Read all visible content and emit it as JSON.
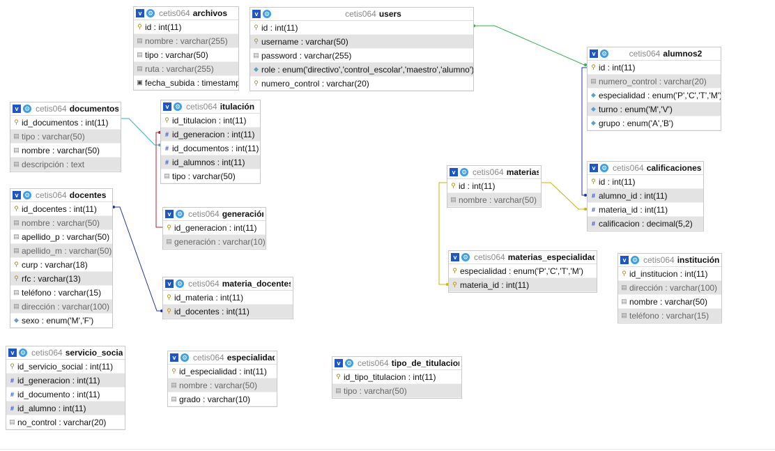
{
  "db_prefix": "cetis064",
  "colors": {
    "rel_green": "#2fb34a",
    "rel_blue": "#2233aa",
    "rel_red": "#b02030",
    "rel_yellow": "#d4b000",
    "rel_cyan": "#28b4c8"
  },
  "tables": {
    "archivos": {
      "name": "archivos",
      "rows": [
        {
          "key": "pk",
          "text": "id : int(11)"
        },
        {
          "key": "plain",
          "text": "nombre : varchar(255)"
        },
        {
          "key": "plain",
          "text": "tipo : varchar(50)"
        },
        {
          "key": "plain",
          "text": "ruta : varchar(255)"
        },
        {
          "key": "idx",
          "text": "fecha_subida : timestamp"
        }
      ]
    },
    "users": {
      "name": "users",
      "rows": [
        {
          "key": "pk",
          "text": "id : int(11)"
        },
        {
          "key": "pk",
          "text": "username : varchar(50)"
        },
        {
          "key": "plain",
          "text": "password : varchar(255)"
        },
        {
          "key": "en",
          "text": "role : enum('directivo','control_escolar','maestro','alumno')"
        },
        {
          "key": "pk",
          "text": "numero_control : varchar(20)"
        }
      ]
    },
    "alumnos2": {
      "name": "alumnos2",
      "rows": [
        {
          "key": "pk",
          "text": "id : int(11)"
        },
        {
          "key": "plain",
          "text": "numero_control : varchar(20)"
        },
        {
          "key": "en",
          "text": "especialidad : enum('P','C','T','M')"
        },
        {
          "key": "en",
          "text": "turno : enum('M','V')"
        },
        {
          "key": "en",
          "text": "grupo : enum('A','B')"
        }
      ]
    },
    "documentos": {
      "name": "documentos",
      "rows": [
        {
          "key": "pk",
          "text": "id_documentos : int(11)"
        },
        {
          "key": "plain",
          "text": "tipo : varchar(50)"
        },
        {
          "key": "plain",
          "text": "nombre : varchar(50)"
        },
        {
          "key": "plain",
          "text": "descripción : text"
        }
      ]
    },
    "titulacion": {
      "name": "itulación",
      "rows": [
        {
          "key": "pk",
          "text": "id_titulacion : int(11)"
        },
        {
          "key": "fk",
          "text": "id_generacion : int(11)"
        },
        {
          "key": "fk",
          "text": "id_documentos : int(11)"
        },
        {
          "key": "fk",
          "text": "id_alumnos : int(11)"
        },
        {
          "key": "plain",
          "text": "tipo : varchar(50)"
        }
      ]
    },
    "docentes": {
      "name": "docentes",
      "rows": [
        {
          "key": "pk",
          "text": "id_docentes : int(11)"
        },
        {
          "key": "plain",
          "text": "nombre : varchar(50)"
        },
        {
          "key": "plain",
          "text": "apellido_p : varchar(50)"
        },
        {
          "key": "plain",
          "text": "apellido_m : varchar(50)"
        },
        {
          "key": "pk",
          "text": "curp : varchar(18)"
        },
        {
          "key": "pk",
          "text": "rfc : varchar(13)"
        },
        {
          "key": "plain",
          "text": "teléfono : varchar(15)"
        },
        {
          "key": "plain",
          "text": "dirección : varchar(100)"
        },
        {
          "key": "en",
          "text": "sexo : enum('M','F')"
        }
      ]
    },
    "generacion": {
      "name": "generación",
      "rows": [
        {
          "key": "pk",
          "text": "id_generacion : int(11)"
        },
        {
          "key": "plain",
          "text": "generación : varchar(10)"
        }
      ]
    },
    "materias": {
      "name": "materias",
      "rows": [
        {
          "key": "pk",
          "text": "id : int(11)"
        },
        {
          "key": "plain",
          "text": "nombre : varchar(50)"
        }
      ]
    },
    "calificaciones": {
      "name": "calificaciones",
      "rows": [
        {
          "key": "pk",
          "text": "id : int(11)"
        },
        {
          "key": "fk",
          "text": "alumno_id : int(11)"
        },
        {
          "key": "fk",
          "text": "materia_id : int(11)"
        },
        {
          "key": "fk",
          "text": "calificacion : decimal(5,2)"
        }
      ]
    },
    "materias_especialidad": {
      "name": "materias_especialidad",
      "rows": [
        {
          "key": "pk",
          "text": "especialidad : enum('P','C','T','M')"
        },
        {
          "key": "pk",
          "text": "materia_id : int(11)"
        }
      ]
    },
    "institucion": {
      "name": "institución",
      "rows": [
        {
          "key": "pk",
          "text": "id_institucion : int(11)"
        },
        {
          "key": "plain",
          "text": "dirección : varchar(100)"
        },
        {
          "key": "plain",
          "text": "nombre : varchar(50)"
        },
        {
          "key": "plain",
          "text": "teléfono : varchar(15)"
        }
      ]
    },
    "materia_docentes": {
      "name": "materia_docentes",
      "rows": [
        {
          "key": "pk",
          "text": "id_materia : int(11)"
        },
        {
          "key": "pk",
          "text": "id_docentes : int(11)"
        }
      ]
    },
    "servicio_social": {
      "name": "servicio_social",
      "rows": [
        {
          "key": "pk",
          "text": "id_servicio_social : int(11)"
        },
        {
          "key": "fk",
          "text": "id_generacion : int(11)"
        },
        {
          "key": "fk",
          "text": "id_documento : int(11)"
        },
        {
          "key": "fk",
          "text": "id_alumno : int(11)"
        },
        {
          "key": "plain",
          "text": "no_control : varchar(20)"
        }
      ]
    },
    "especialidad": {
      "name": "especialidad",
      "rows": [
        {
          "key": "pk",
          "text": "id_especialidad : int(11)"
        },
        {
          "key": "plain",
          "text": "nombre : varchar(50)"
        },
        {
          "key": "plain",
          "text": "grado : varchar(10)"
        }
      ]
    },
    "tipo_de_titulacion": {
      "name": "tipo_de_titulacion",
      "rows": [
        {
          "key": "pk",
          "text": "id_tipo_titulacion : int(11)"
        },
        {
          "key": "plain",
          "text": "tipo : varchar(50)"
        }
      ]
    }
  }
}
